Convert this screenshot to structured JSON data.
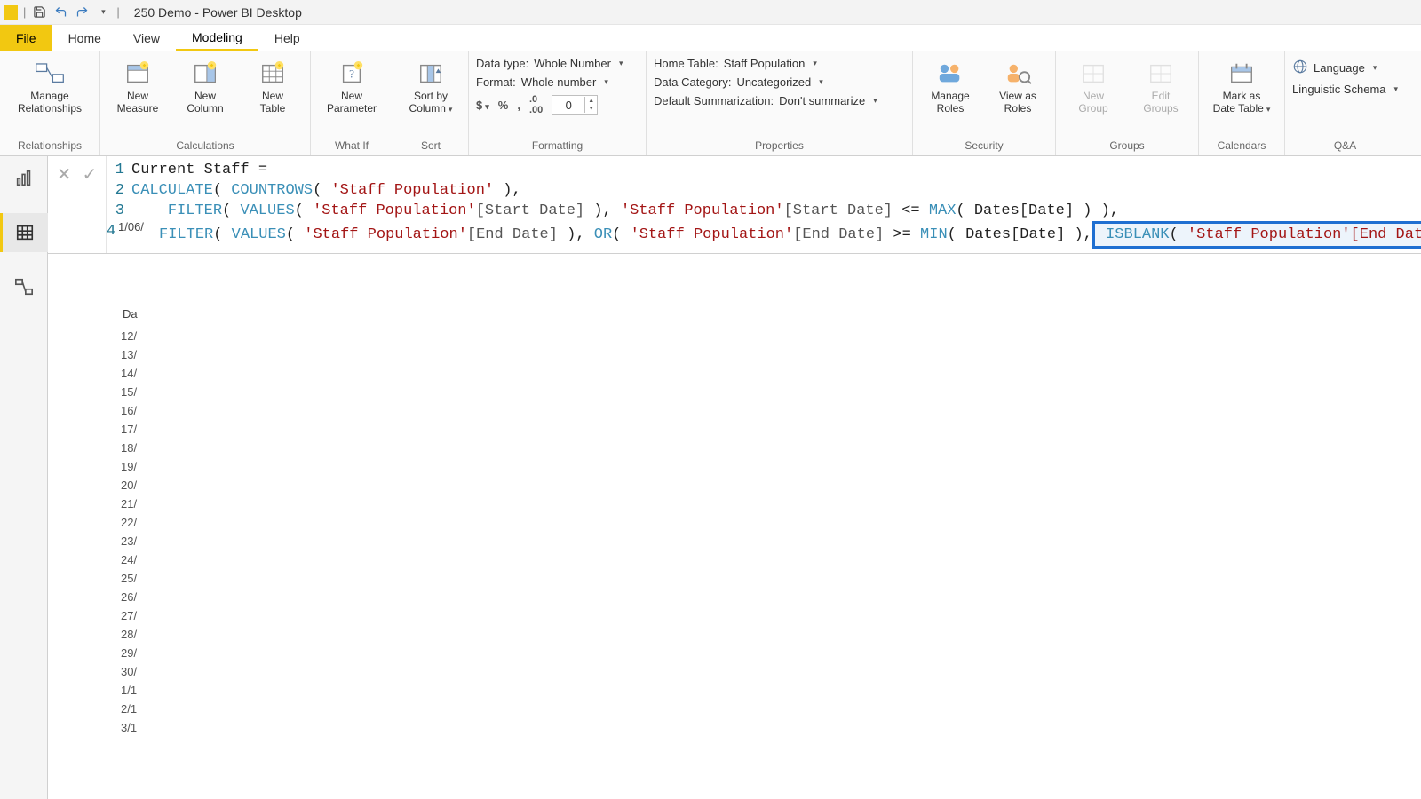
{
  "title": "250 Demo - Power BI Desktop",
  "menu": {
    "file": "File",
    "home": "Home",
    "view": "View",
    "modeling": "Modeling",
    "help": "Help"
  },
  "ribbon": {
    "relationships": {
      "manage": "Manage\nRelationships",
      "group": "Relationships"
    },
    "calculations": {
      "measure": "New\nMeasure",
      "column": "New\nColumn",
      "table": "New\nTable",
      "group": "Calculations"
    },
    "whatif": {
      "param": "New\nParameter",
      "group": "What If"
    },
    "sort": {
      "sortby": "Sort by\nColumn",
      "group": "Sort"
    },
    "formatting": {
      "datatype_label": "Data type:",
      "datatype_value": "Whole Number",
      "format_label": "Format:",
      "format_value": "Whole number",
      "decimals": "0",
      "group": "Formatting"
    },
    "properties": {
      "hometable_label": "Home Table:",
      "hometable_value": "Staff Population",
      "datacat_label": "Data Category:",
      "datacat_value": "Uncategorized",
      "summ_label": "Default Summarization:",
      "summ_value": "Don't summarize",
      "group": "Properties"
    },
    "security": {
      "manage": "Manage\nRoles",
      "viewas": "View as\nRoles",
      "group": "Security"
    },
    "groups": {
      "new": "New\nGroup",
      "edit": "Edit\nGroups",
      "group": "Groups"
    },
    "calendars": {
      "mark": "Mark as\nDate Table",
      "group": "Calendars"
    },
    "qa": {
      "lang": "Language",
      "schema": "Linguistic Schema",
      "group": "Q&A"
    }
  },
  "formula": {
    "l1": "Current Staff =",
    "l2_a": "CALCULATE",
    "l2_b": "COUNTROWS",
    "l2_c": "'Staff Population'",
    "l3_filter": "FILTER",
    "l3_values": "VALUES",
    "l3_tbl": "'Staff Population'",
    "l3_col": "[Start Date]",
    "l3_max": "MAX",
    "l3_dates": "Dates[Date]",
    "l4_filter": "FILTER",
    "l4_values": "VALUES",
    "l4_tbl": "'Staff Population'",
    "l4_col": "[End Date]",
    "l4_or": "OR",
    "l4_min": "MIN",
    "l4_dates": "Dates[Date]",
    "l4_isblank": "ISBLANK",
    "l4_isblank_arg": "'Staff Population'[End Date]"
  },
  "data_sliver": {
    "date_label": "Date",
    "cell_value": "1/06/",
    "col_header": "Da",
    "rows": [
      "12/",
      "13/",
      "14/",
      "15/",
      "16/",
      "17/",
      "18/",
      "19/",
      "20/",
      "21/",
      "22/",
      "23/",
      "24/",
      "25/",
      "26/",
      "27/",
      "28/",
      "29/",
      "30/",
      "1/1",
      "2/1",
      "3/1"
    ]
  }
}
